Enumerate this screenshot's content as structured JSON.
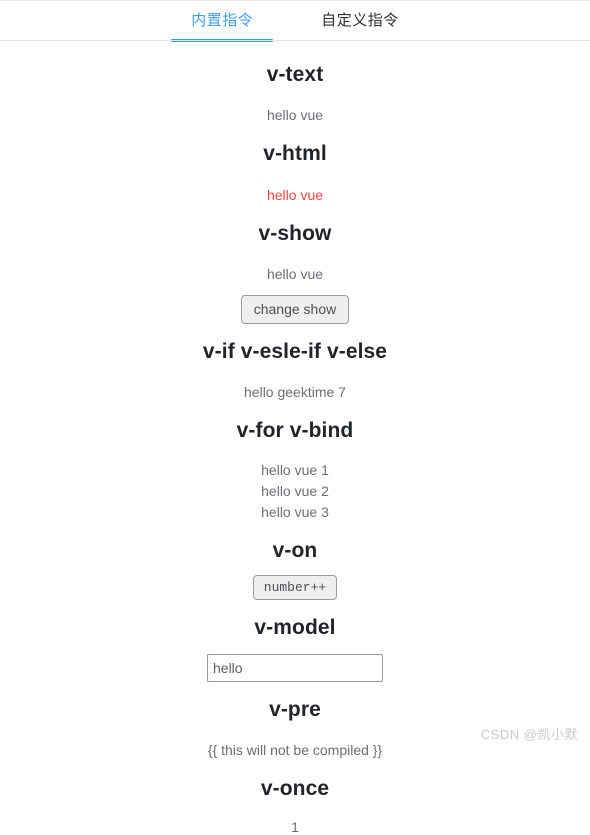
{
  "tabs": [
    {
      "label": "内置指令",
      "active": true
    },
    {
      "label": "自定义指令",
      "active": false
    }
  ],
  "sections": {
    "v_text": {
      "title": "v-text",
      "output": "hello vue"
    },
    "v_html": {
      "title": "v-html",
      "output": "hello vue",
      "output_color": "#f4483c"
    },
    "v_show": {
      "title": "v-show",
      "output": "hello vue",
      "button_label": "change show"
    },
    "v_if": {
      "title": "v-if v-esle-if v-else",
      "output": "hello geektime 7"
    },
    "v_for": {
      "title": "v-for v-bind",
      "items": [
        "hello vue 1",
        "hello vue 2",
        "hello vue 3"
      ]
    },
    "v_on": {
      "title": "v-on",
      "button_label": "number++"
    },
    "v_model": {
      "title": "v-model",
      "input_value": "hello",
      "input_placeholder": "hello"
    },
    "v_pre": {
      "title": "v-pre",
      "output": "{{ this will not be compiled }}"
    },
    "v_once": {
      "title": "v-once",
      "output": "1"
    }
  },
  "watermark": "CSDN @凯小默",
  "colors": {
    "accent": "#409eff",
    "tab_underline": "#3a9bdc",
    "heading": "#212529",
    "body_text": "#6a6f76",
    "danger": "#f4483c"
  }
}
